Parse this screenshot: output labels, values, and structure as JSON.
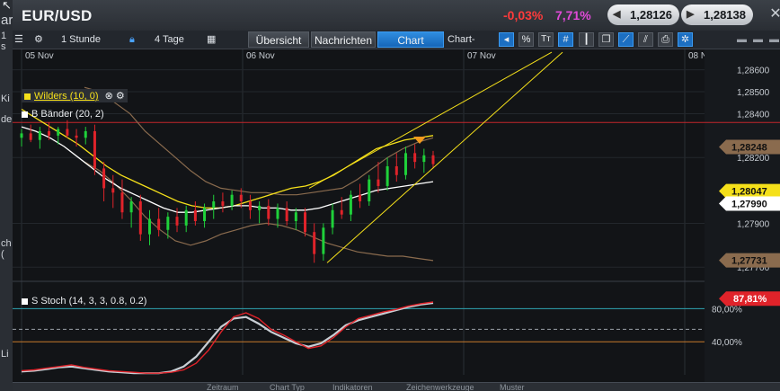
{
  "window": {
    "title": "EUR/USD",
    "change_abs": "-0,03%",
    "change_pct": "7,71%",
    "bid": "1,28126",
    "ask": "1,28138",
    "close_icon": "close-icon"
  },
  "left_strip": {
    "a": "ar",
    "b": "1 s",
    "c": "Ki",
    "d": "de",
    "e": "ch (",
    "f": "Li"
  },
  "toolbar": {
    "interval": "1 Stunde",
    "range": "4 Tage",
    "tabs": [
      "Übersicht",
      "Nachrichten",
      "Chart"
    ],
    "active_tab": "Chart",
    "tools_label": "Chart-Tools"
  },
  "legend": {
    "wilders": "Wilders (10, 0)",
    "bands": "B Bänder (20, 2)",
    "stoch": "S Stoch (14, 3, 3, 0.8, 0.2)"
  },
  "bottom_tabs": [
    "Zeitraum",
    "Chart Typ",
    "Indikatoren",
    "Zeichenwerkzeuge",
    "Muster"
  ],
  "colors": {
    "up": "#1fd13a",
    "down": "#e0232a",
    "wilders": "#f5e01a",
    "band": "#8a6b4e",
    "ma": "#ffffff",
    "accent": "#1666b8"
  },
  "chart_data": {
    "type": "candlestick",
    "x_ticks": [
      "05 Nov",
      "06 Nov",
      "07 Nov",
      "08 Nov"
    ],
    "y_ticks": [
      1.286,
      1.285,
      1.284,
      1.282,
      1.279,
      1.277
    ],
    "y_tick_labels": [
      "1,28600",
      "1,28500",
      "1,28400",
      "1,28200",
      "1,27900",
      "1,27700"
    ],
    "ylim": [
      1.2766,
      1.2866
    ],
    "price_labels": [
      {
        "label": "1,28248",
        "value": 1.28248,
        "color": "#8a6b4e"
      },
      {
        "label": "1,28047",
        "value": 1.28047,
        "color": "#f5e01a"
      },
      {
        "label": "1,27990",
        "value": 1.2799,
        "color": "#ffffff"
      },
      {
        "label": "1,27731",
        "value": 1.27731,
        "color": "#8a6b4e"
      }
    ],
    "stoch": {
      "levels": [
        "80,00%",
        "40,00%"
      ],
      "current": "87,81%",
      "current_value": 87.81
    },
    "candles": [
      [
        1.2829,
        1.2833,
        1.2825,
        1.2831
      ],
      [
        1.2831,
        1.2835,
        1.2827,
        1.2828
      ],
      [
        1.2828,
        1.2834,
        1.2824,
        1.2832
      ],
      [
        1.2832,
        1.2836,
        1.2828,
        1.283
      ],
      [
        1.283,
        1.2834,
        1.2826,
        1.2833
      ],
      [
        1.2833,
        1.2837,
        1.2829,
        1.283
      ],
      [
        1.283,
        1.2833,
        1.2825,
        1.2829
      ],
      [
        1.2829,
        1.2834,
        1.2826,
        1.2832
      ],
      [
        1.2832,
        1.2835,
        1.2812,
        1.2815
      ],
      [
        1.2815,
        1.2818,
        1.28,
        1.2806
      ],
      [
        1.2806,
        1.2812,
        1.2797,
        1.2804
      ],
      [
        1.2804,
        1.281,
        1.2792,
        1.2795
      ],
      [
        1.2795,
        1.2802,
        1.2788,
        1.28
      ],
      [
        1.28,
        1.2803,
        1.2782,
        1.2785
      ],
      [
        1.2785,
        1.2796,
        1.278,
        1.2792
      ],
      [
        1.2792,
        1.2797,
        1.2784,
        1.2787
      ],
      [
        1.2787,
        1.2795,
        1.2783,
        1.2793
      ],
      [
        1.2793,
        1.2797,
        1.2786,
        1.2789
      ],
      [
        1.2789,
        1.2798,
        1.2786,
        1.2796
      ],
      [
        1.2796,
        1.28,
        1.2789,
        1.2791
      ],
      [
        1.2791,
        1.2799,
        1.2788,
        1.2797
      ],
      [
        1.2797,
        1.2803,
        1.2792,
        1.28
      ],
      [
        1.28,
        1.2804,
        1.2795,
        1.2798
      ],
      [
        1.2798,
        1.2805,
        1.2796,
        1.2803
      ],
      [
        1.2803,
        1.2806,
        1.2797,
        1.28
      ],
      [
        1.28,
        1.2803,
        1.2792,
        1.2796
      ],
      [
        1.2796,
        1.28,
        1.279,
        1.2798
      ],
      [
        1.2798,
        1.2801,
        1.2789,
        1.2792
      ],
      [
        1.2792,
        1.2799,
        1.2788,
        1.2797
      ],
      [
        1.2797,
        1.28,
        1.2789,
        1.2791
      ],
      [
        1.2791,
        1.2797,
        1.2787,
        1.2795
      ],
      [
        1.2795,
        1.2797,
        1.2784,
        1.2786
      ],
      [
        1.2786,
        1.279,
        1.2772,
        1.2776
      ],
      [
        1.2776,
        1.279,
        1.2773,
        1.2788
      ],
      [
        1.2788,
        1.2799,
        1.2785,
        1.2796
      ],
      [
        1.2796,
        1.2802,
        1.2792,
        1.2794
      ],
      [
        1.2794,
        1.2805,
        1.2791,
        1.2803
      ],
      [
        1.2803,
        1.2808,
        1.2797,
        1.28
      ],
      [
        1.28,
        1.2812,
        1.2798,
        1.281
      ],
      [
        1.281,
        1.2818,
        1.2804,
        1.2807
      ],
      [
        1.2807,
        1.282,
        1.2805,
        1.2816
      ],
      [
        1.2816,
        1.2822,
        1.2809,
        1.2812
      ],
      [
        1.2812,
        1.2825,
        1.281,
        1.2822
      ],
      [
        1.2822,
        1.2826,
        1.2815,
        1.2818
      ],
      [
        1.2818,
        1.2824,
        1.2813,
        1.2821
      ],
      [
        1.2821,
        1.2823,
        1.2815,
        1.2817
      ]
    ],
    "wilders": [
      1.2842,
      1.2838,
      1.2834,
      1.283,
      1.2826,
      1.2821,
      1.2816,
      1.2812,
      1.2809,
      1.2806,
      1.2803,
      1.28,
      1.2798,
      1.2797,
      1.2797,
      1.2798,
      1.28,
      1.2802,
      1.2804,
      1.2806,
      1.2807,
      1.2809,
      1.2812,
      1.2816,
      1.282,
      1.2824,
      1.2826,
      1.2828,
      1.2829,
      1.283
    ],
    "ma": [
      1.2834,
      1.2832,
      1.2829,
      1.2825,
      1.282,
      1.2815,
      1.281,
      1.2806,
      1.2803,
      1.28,
      1.2797,
      1.2795,
      1.2795,
      1.2796,
      1.2797,
      1.2798,
      1.2798,
      1.2797,
      1.2797,
      1.2796,
      1.2796,
      1.2797,
      1.2799,
      1.2801,
      1.2803,
      1.2805,
      1.2806,
      1.2807,
      1.2808,
      1.2809
    ],
    "band_up": [
      1.2852,
      1.285,
      1.2845,
      1.284,
      1.2832,
      1.2826,
      1.282,
      1.2814,
      1.2809,
      1.2806,
      1.2805,
      1.2804,
      1.2804,
      1.2803,
      1.2803,
      1.2804,
      1.2805,
      1.2806,
      1.281,
      1.2815,
      1.282,
      1.2824,
      1.2827,
      1.2829
    ],
    "band_dn": [
      1.2818,
      1.2814,
      1.2808,
      1.2801,
      1.2793,
      1.2787,
      1.2782,
      1.278,
      1.2782,
      1.2785,
      1.2787,
      1.2789,
      1.279,
      1.2789,
      1.2787,
      1.2784,
      1.2781,
      1.2779,
      1.2777,
      1.2776,
      1.2775,
      1.2775,
      1.2774,
      1.2773
    ],
    "stoch_k": [
      5,
      6,
      8,
      10,
      12,
      9,
      7,
      5,
      4,
      3,
      2,
      2,
      3,
      6,
      14,
      30,
      52,
      70,
      75,
      68,
      55,
      48,
      40,
      32,
      35,
      45,
      58,
      68,
      72,
      76,
      79,
      83,
      86,
      88
    ],
    "stoch_d": [
      4,
      5,
      7,
      9,
      10,
      8,
      6,
      4,
      3,
      2,
      2,
      2,
      4,
      10,
      22,
      40,
      58,
      68,
      70,
      62,
      52,
      45,
      38,
      34,
      38,
      48,
      60,
      66,
      70,
      74,
      78,
      82,
      85,
      87
    ]
  }
}
